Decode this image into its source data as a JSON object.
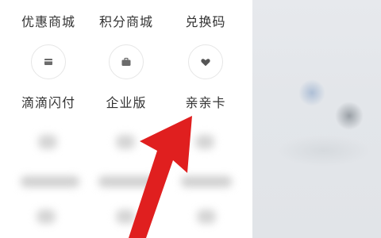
{
  "grid": {
    "row1": [
      {
        "label": "优惠商城"
      },
      {
        "label": "积分商城"
      },
      {
        "label": "兑换码"
      }
    ],
    "row2_icons": [
      "card-icon",
      "briefcase-icon",
      "heart-icon"
    ],
    "row3": [
      {
        "label": "滴滴闪付"
      },
      {
        "label": "企业版"
      },
      {
        "label": "亲亲卡"
      }
    ]
  },
  "colors": {
    "arrow": "#e01f1f",
    "text": "#333333",
    "overlay": "#e3e6ea"
  }
}
